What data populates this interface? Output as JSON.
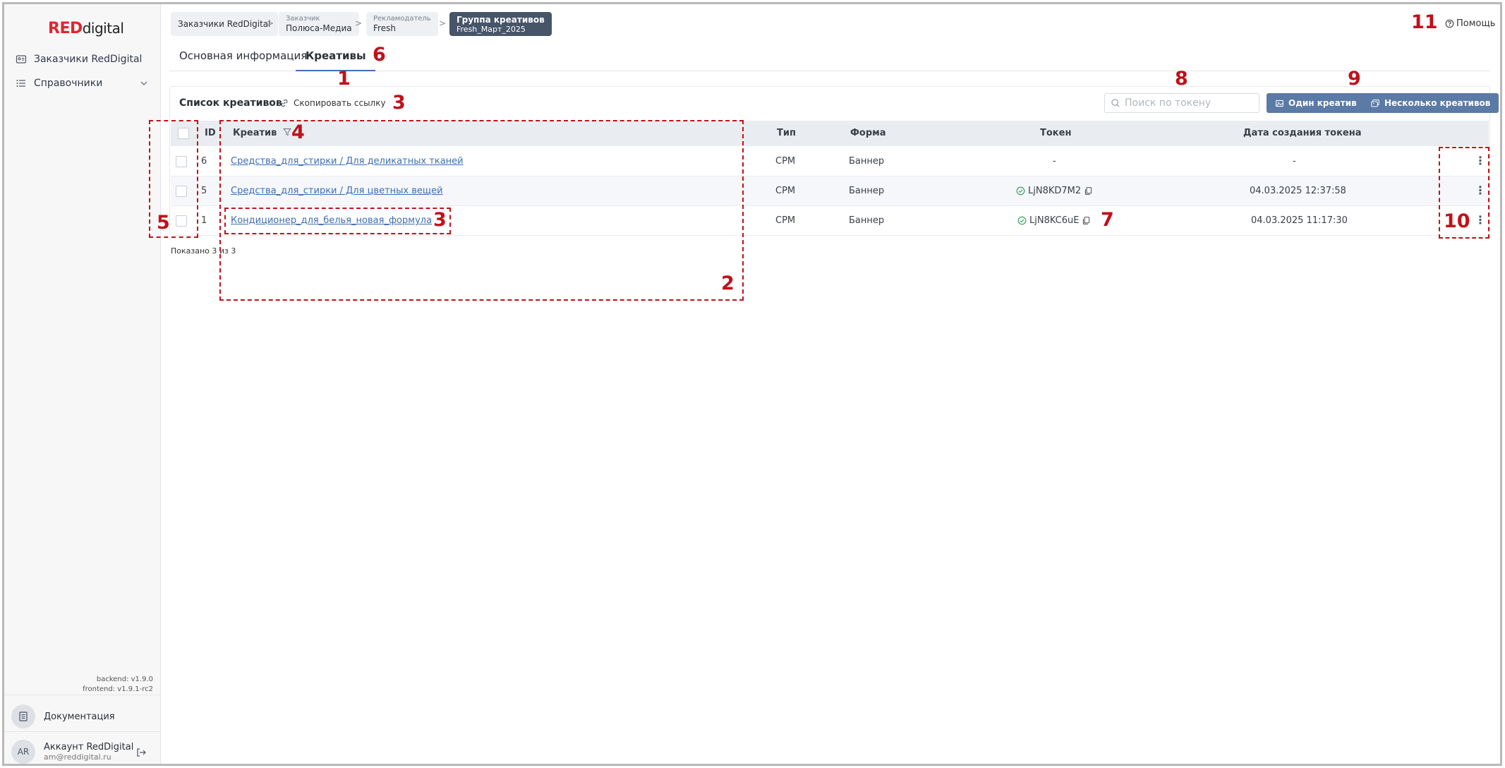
{
  "logo": {
    "red": "RED",
    "digital": "digital"
  },
  "sidebar": {
    "items": [
      {
        "label": "Заказчики RedDigital",
        "icon": "id-card-icon"
      },
      {
        "label": "Справочники",
        "icon": "list-icon"
      }
    ],
    "versions": {
      "backend": "backend: v1.9.0",
      "frontend": "frontend: v1.9.1-rc2"
    },
    "docs_label": "Документация",
    "account": {
      "initials": "AR",
      "name": "Аккаунт RedDigital",
      "email": "am@reddigital.ru"
    }
  },
  "breadcrumb": [
    {
      "label": "Заказчики RedDigital"
    },
    {
      "small": "Заказчик",
      "label": "Полюса-Медиа"
    },
    {
      "small": "Рекламодатель",
      "label": "Fresh"
    },
    {
      "label": "Группа креативов",
      "sub": "Fresh_Март_2025"
    }
  ],
  "help_label": "Помощь",
  "tabs": [
    {
      "label": "Основная информация"
    },
    {
      "label": "Креативы"
    }
  ],
  "list": {
    "title": "Список креативов",
    "copy_link": "Скопировать ссылку",
    "search_placeholder": "Поиск по токену",
    "btn_one": "Один креатив",
    "btn_many": "Несколько креативов"
  },
  "table": {
    "headers": {
      "id": "ID",
      "creative": "Креатив",
      "type": "Тип",
      "form": "Форма",
      "token": "Токен",
      "date": "Дата создания токена"
    },
    "rows": [
      {
        "id": "6",
        "creative": "Средства_для_стирки / Для деликатных тканей",
        "type": "CPM",
        "form": "Баннер",
        "token": "-",
        "date": "-"
      },
      {
        "id": "5",
        "creative": "Средства_для_стирки / Для цветных вещей",
        "type": "CPM",
        "form": "Баннер",
        "token": "LjN8KD7M2",
        "date": "04.03.2025 12:37:58"
      },
      {
        "id": "1",
        "creative": "Кондиционер_для_белья_новая_формула",
        "type": "CPM",
        "form": "Баннер",
        "token": "LjN8KC6uE",
        "date": "04.03.2025 11:17:30"
      }
    ],
    "shown": "Показано 3 из 3"
  },
  "annotations": [
    "1",
    "2",
    "3",
    "3",
    "4",
    "5",
    "6",
    "7",
    "8",
    "9",
    "10",
    "11"
  ],
  "colors": {
    "brand_red": "#e0262f",
    "accent_blue": "#3e6fb3",
    "button": "#5b7aa6",
    "annotation": "#c0111a"
  }
}
